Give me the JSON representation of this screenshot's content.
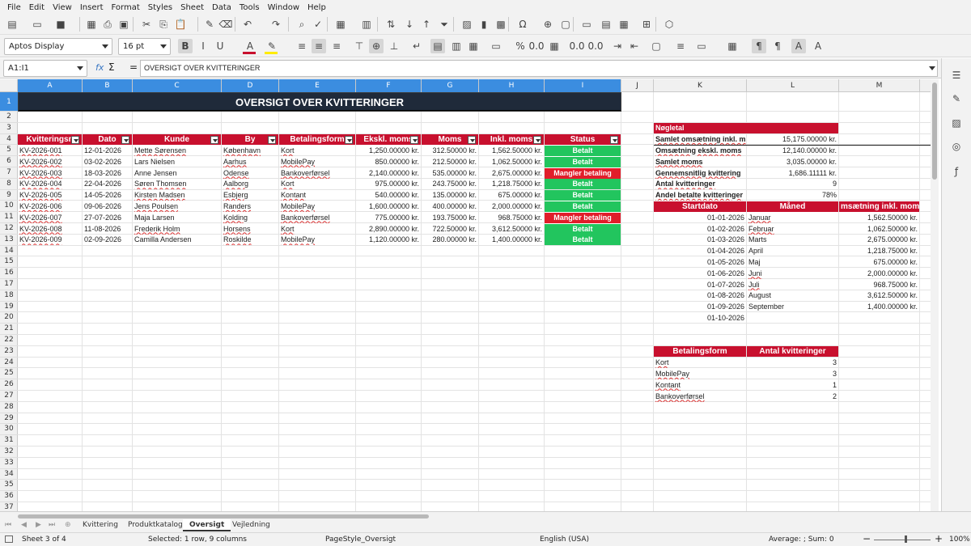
{
  "menu": [
    "File",
    "Edit",
    "View",
    "Insert",
    "Format",
    "Styles",
    "Sheet",
    "Data",
    "Tools",
    "Window",
    "Help"
  ],
  "toolbar": {
    "font_name": "Aptos Display",
    "font_size": "16 pt"
  },
  "formula": {
    "name_box": "A1:I1",
    "fx": "fx",
    "sigma": "Σ",
    "eq": "=",
    "content": "OVERSIGT OVER KVITTERINGER"
  },
  "columns": [
    "A",
    "B",
    "C",
    "D",
    "E",
    "F",
    "G",
    "H",
    "I",
    "J",
    "K",
    "L",
    "M"
  ],
  "rows": [
    "1",
    "2",
    "3",
    "4",
    "5",
    "6",
    "7",
    "8",
    "9",
    "10",
    "11",
    "12",
    "13",
    "14",
    "15",
    "16",
    "17",
    "18",
    "19",
    "20",
    "21",
    "22",
    "23",
    "24",
    "25",
    "26",
    "27",
    "28",
    "29",
    "30",
    "31",
    "32",
    "33",
    "34",
    "35",
    "36",
    "37"
  ],
  "title": "OVERSIGT OVER KVITTERINGER",
  "table_headers": [
    "Kvitteringsn",
    "Dato",
    "Kunde",
    "By",
    "Betalingsform",
    "Ekskl. moms",
    "Moms",
    "Inkl. moms",
    "Status"
  ],
  "table_rows": [
    [
      "KV-2026-001",
      "12-01-2026",
      "Mette Sørensen",
      "København",
      "Kort",
      "1,250.00000 kr.",
      "312.50000 kr.",
      "1,562.50000 kr.",
      "Betalt"
    ],
    [
      "KV-2026-002",
      "03-02-2026",
      "Lars Nielsen",
      "Aarhus",
      "MobilePay",
      "850.00000 kr.",
      "212.50000 kr.",
      "1,062.50000 kr.",
      "Betalt"
    ],
    [
      "KV-2026-003",
      "18-03-2026",
      "Anne Jensen",
      "Odense",
      "Bankoverførsel",
      "2,140.00000 kr.",
      "535.00000 kr.",
      "2,675.00000 kr.",
      "Mangler betaling"
    ],
    [
      "KV-2026-004",
      "22-04-2026",
      "Søren Thomsen",
      "Aalborg",
      "Kort",
      "975.00000 kr.",
      "243.75000 kr.",
      "1,218.75000 kr.",
      "Betalt"
    ],
    [
      "KV-2026-005",
      "14-05-2026",
      "Kirsten Madsen",
      "Esbjerg",
      "Kontant",
      "540.00000 kr.",
      "135.00000 kr.",
      "675.00000 kr.",
      "Betalt"
    ],
    [
      "KV-2026-006",
      "09-06-2026",
      "Jens Poulsen",
      "Randers",
      "MobilePay",
      "1,600.00000 kr.",
      "400.00000 kr.",
      "2,000.00000 kr.",
      "Betalt"
    ],
    [
      "KV-2026-007",
      "27-07-2026",
      "Maja Larsen",
      "Kolding",
      "Bankoverførsel",
      "775.00000 kr.",
      "193.75000 kr.",
      "968.75000 kr.",
      "Mangler betaling"
    ],
    [
      "KV-2026-008",
      "11-08-2026",
      "Frederik Holm",
      "Horsens",
      "Kort",
      "2,890.00000 kr.",
      "722.50000 kr.",
      "3,612.50000 kr.",
      "Betalt"
    ],
    [
      "KV-2026-009",
      "02-09-2026",
      "Camilla Andersen",
      "Roskilde",
      "MobilePay",
      "1,120.00000 kr.",
      "280.00000 kr.",
      "1,400.00000 kr.",
      "Betalt"
    ]
  ],
  "kpi": {
    "header": "Nøgletal",
    "items": [
      [
        "Samlet omsætning inkl. m",
        "15,175.00000 kr."
      ],
      [
        "Omsætning ekskl. moms",
        "12,140.00000 kr."
      ],
      [
        "Samlet moms",
        "3,035.00000 kr."
      ],
      [
        "Gennemsnitlig kvittering",
        "1,686.11111 kr."
      ],
      [
        "Antal kvitteringer",
        "9"
      ],
      [
        "Andel betalte kvitteringer",
        "78%"
      ]
    ]
  },
  "monthly": {
    "headers": [
      "Startdato",
      "Måned",
      "msætning inkl. mom"
    ],
    "rows": [
      [
        "01-01-2026",
        "Januar",
        "1,562.50000 kr."
      ],
      [
        "01-02-2026",
        "Februar",
        "1,062.50000 kr."
      ],
      [
        "01-03-2026",
        "Marts",
        "2,675.00000 kr."
      ],
      [
        "01-04-2026",
        "April",
        "1,218.75000 kr."
      ],
      [
        "01-05-2026",
        "Maj",
        "675.00000 kr."
      ],
      [
        "01-06-2026",
        "Juni",
        "2,000.00000 kr."
      ],
      [
        "01-07-2026",
        "Juli",
        "968.75000 kr."
      ],
      [
        "01-08-2026",
        "August",
        "3,612.50000 kr."
      ],
      [
        "01-09-2026",
        "September",
        "1,400.00000 kr."
      ],
      [
        "01-10-2026",
        "",
        ""
      ]
    ]
  },
  "payment": {
    "headers": [
      "Betalingsform",
      "Antal kvitteringer"
    ],
    "rows": [
      [
        "Kort",
        "3"
      ],
      [
        "MobilePay",
        "3"
      ],
      [
        "Kontant",
        "1"
      ],
      [
        "Bankoverførsel",
        "2"
      ]
    ]
  },
  "tabs": [
    "Kvittering",
    "Produktkatalog",
    "Oversigt",
    "Vejledning"
  ],
  "active_tab": "Oversigt",
  "status": {
    "sheet": "Sheet 3 of 4",
    "selection": "Selected: 1 row, 9 columns",
    "pagestyle": "PageStyle_Oversigt",
    "language": "English (USA)",
    "calc": "Average: ; Sum: 0",
    "zoom": "100%"
  },
  "colors": {
    "red": "#c8102e",
    "green": "#22c55e",
    "title_bg": "#1f2a3a",
    "select": "#3b8de0"
  }
}
